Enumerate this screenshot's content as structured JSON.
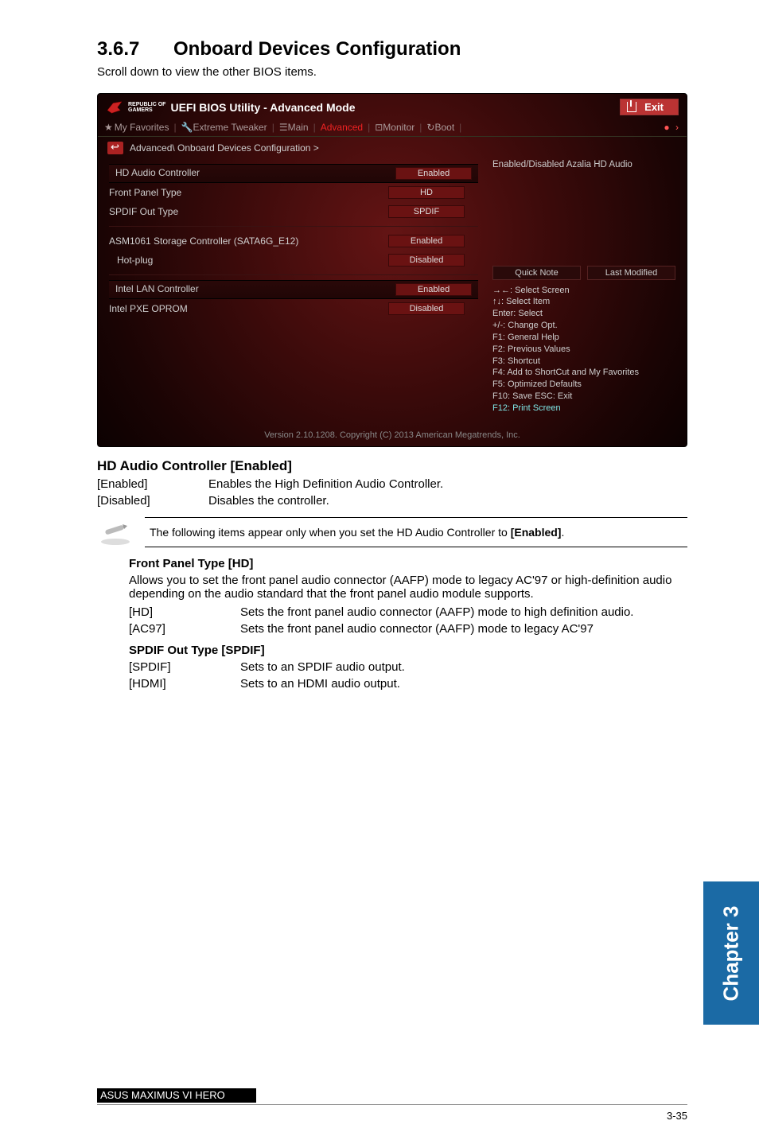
{
  "section": {
    "number": "3.6.7",
    "title": "Onboard Devices Configuration",
    "subtitle": "Scroll down to view the other BIOS items."
  },
  "bios": {
    "brand_top": "REPUBLIC OF",
    "brand_bottom": "GAMERS",
    "title": "UEFI BIOS Utility - Advanced Mode",
    "exit": "Exit",
    "tabs": {
      "fav": "My Favorites",
      "tweaker": "Extreme Tweaker",
      "main": "Main",
      "advanced": "Advanced",
      "monitor": "Monitor",
      "boot": "Boot"
    },
    "breadcrumb": "Advanced\\ Onboard Devices Configuration >",
    "rows": {
      "hd_audio_label": "HD Audio Controller",
      "hd_audio_value": "Enabled",
      "front_panel_label": "Front Panel Type",
      "front_panel_value": "HD",
      "spdif_label": "SPDIF Out Type",
      "spdif_value": "SPDIF",
      "asm_label": "ASM1061 Storage Controller (SATA6G_E12)",
      "asm_value": "Enabled",
      "hotplug_label": "Hot-plug",
      "hotplug_value": "Disabled",
      "lan_label": "Intel LAN Controller",
      "lan_value": "Enabled",
      "pxe_label": "Intel PXE OPROM",
      "pxe_value": "Disabled"
    },
    "info_line": "Enabled/Disabled Azalia HD Audio",
    "quick_note": "Quick Note",
    "last_modified": "Last Modified",
    "help": {
      "l1": "→←: Select Screen",
      "l2": "↑↓: Select Item",
      "l3": "Enter: Select",
      "l4": "+/-: Change Opt.",
      "l5": "F1: General Help",
      "l6": "F2: Previous Values",
      "l7": "F3: Shortcut",
      "l8": "F4: Add to ShortCut and My Favorites",
      "l9": "F5: Optimized Defaults",
      "l10": "F10: Save  ESC: Exit",
      "l11": "F12: Print Screen"
    },
    "footer": "Version 2.10.1208. Copyright (C) 2013 American Megatrends, Inc."
  },
  "doc": {
    "h_hd": "HD Audio Controller [Enabled]",
    "hd_rows": [
      {
        "key": "[Enabled]",
        "val": "Enables the High Definition Audio Controller."
      },
      {
        "key": "[Disabled]",
        "val": "Disables the controller."
      }
    ],
    "note": "The following items appear only when you set the HD Audio Controller to [Enabled].",
    "h_fpt": "Front Panel Type [HD]",
    "fpt_desc": "Allows you to set the front panel audio connector (AAFP) mode to legacy AC'97 or high-definition audio depending on the audio standard that the front panel audio module supports.",
    "fpt_rows": [
      {
        "key": "[HD]",
        "val": "Sets the front panel audio connector (AAFP) mode to high definition audio."
      },
      {
        "key": "[AC97]",
        "val": "Sets the front panel audio connector (AAFP) mode to legacy AC'97"
      }
    ],
    "h_spdif": "SPDIF Out Type [SPDIF]",
    "spdif_rows": [
      {
        "key": "[SPDIF]",
        "val": "Sets to an SPDIF audio output."
      },
      {
        "key": "[HDMI]",
        "val": "Sets to an HDMI audio output."
      }
    ]
  },
  "side_tab": "Chapter 3",
  "footer": {
    "product": "ASUS MAXIMUS VI HERO",
    "page": "3-35"
  }
}
